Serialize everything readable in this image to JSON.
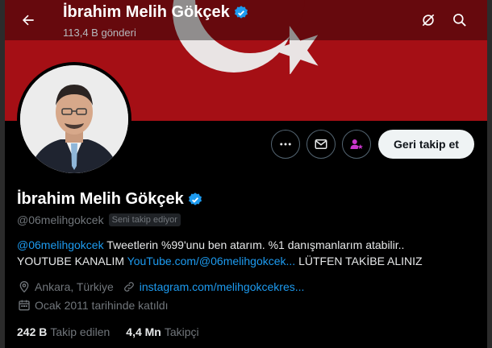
{
  "header": {
    "title": "İbrahim Melih Gökçek",
    "subtitle": "113,4 B gönderi"
  },
  "profile": {
    "name": "İbrahim Melih Gökçek",
    "handle": "@06melihgokcek",
    "follows_you_badge": "Seni takip ediyor",
    "follow_button_label": "Geri takip et"
  },
  "bio": {
    "line1_handle": "@06melihgokcek",
    "line1_text": " Tweetlerin %99'unu ben atarım. %1 danışmanlarım atabilir..",
    "line2_prefix": "YOUTUBE KANALIM ",
    "line2_link": "YouTube.com/@06melihgokcek...",
    "line2_suffix": " LÜTFEN TAKİBE ALINIZ"
  },
  "meta": {
    "location": "Ankara, Türkiye",
    "website": "instagram.com/melihgokcekres...",
    "joined": "Ocak 2011 tarihinde katıldı"
  },
  "stats": {
    "following_count": "242 B",
    "following_label": "Takip edilen",
    "followers_count": "4,4 Mn",
    "followers_label": "Takipçi"
  },
  "icons": [
    "arrow-left-icon",
    "grok-icon",
    "search-icon",
    "more-icon",
    "mail-icon",
    "subscribe-icon",
    "verified-icon",
    "location-icon",
    "link-icon",
    "calendar-icon"
  ],
  "colors": {
    "accent": "#1d9bf0",
    "banner_red": "#a50f15",
    "subscribe_purple": "#c936cc"
  }
}
